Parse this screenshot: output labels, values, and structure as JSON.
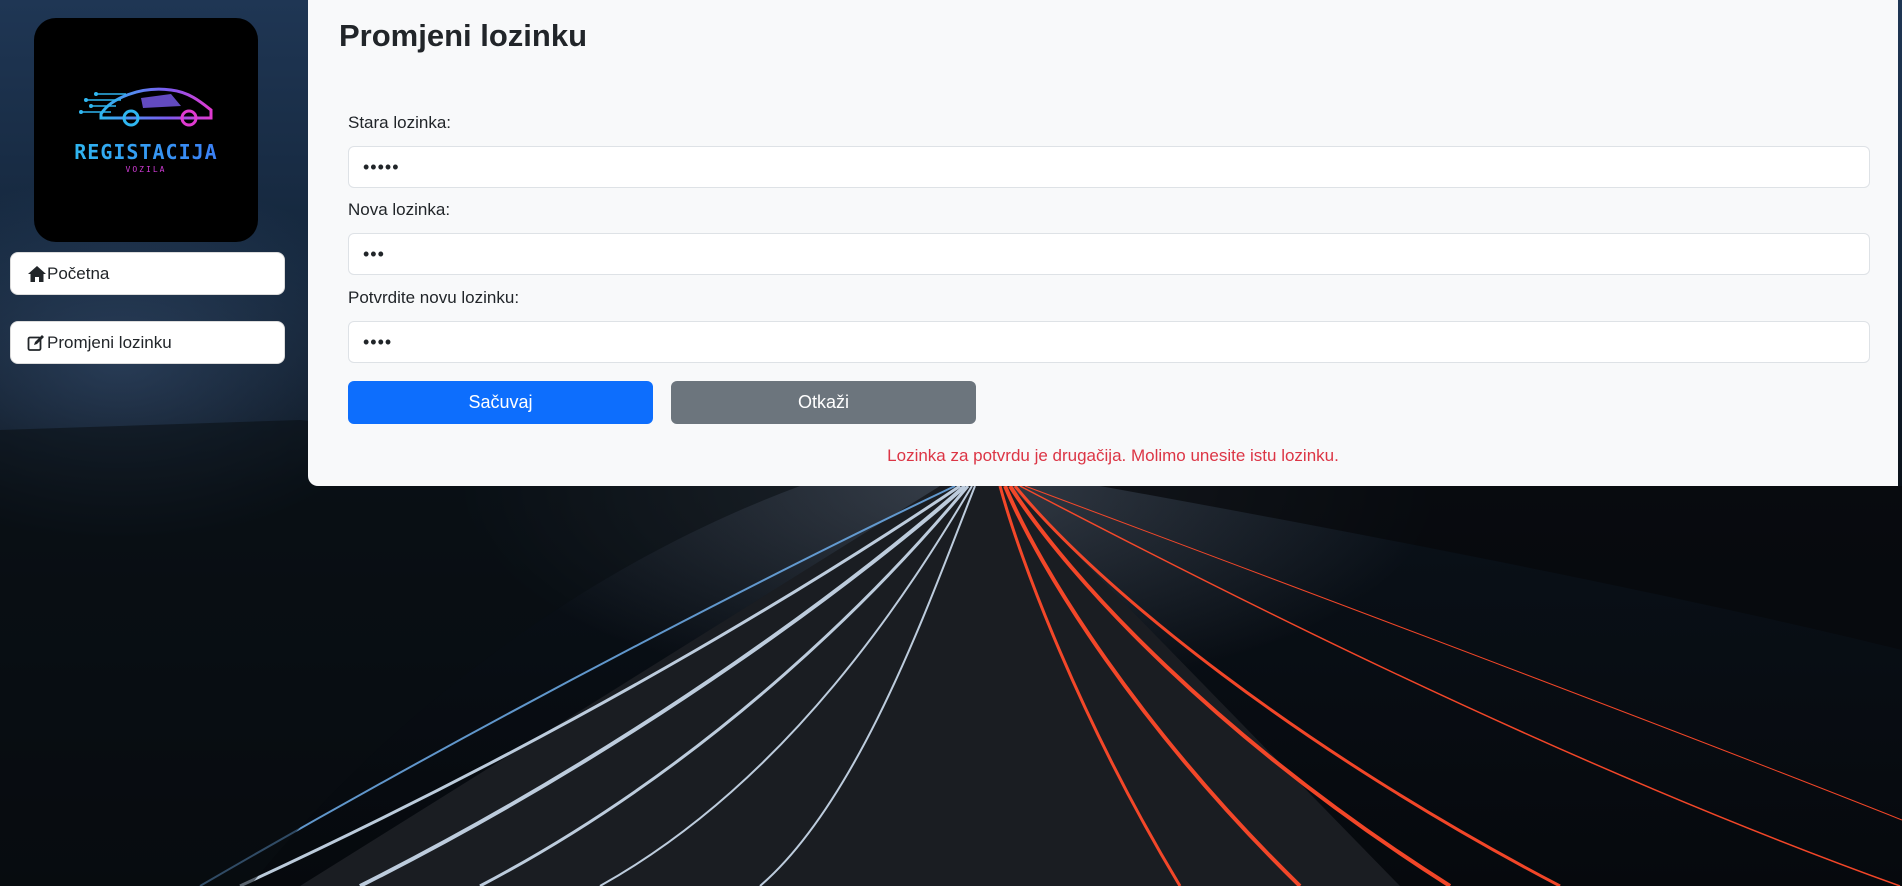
{
  "app": {
    "logo": {
      "title": "REGISTACIJA",
      "subtitle": "VOZILA",
      "colors": {
        "primary": "#2fb6f0",
        "accent": "#d13bd6"
      }
    }
  },
  "sidebar": {
    "items": [
      {
        "label": "Početna",
        "icon": "home-icon"
      },
      {
        "label": "Promjeni lozinku",
        "icon": "edit-icon"
      }
    ]
  },
  "form": {
    "title": "Promjeni lozinku",
    "fields": [
      {
        "label": "Stara lozinka:",
        "value": "•••••"
      },
      {
        "label": "Nova lozinka:",
        "value": "•••"
      },
      {
        "label": "Potvrdite novu lozinku:",
        "value": "••••"
      }
    ],
    "buttons": {
      "save": "Sačuvaj",
      "cancel": "Otkaži"
    },
    "error": "Lozinka za potvrdu je drugačija. Molimo unesite istu lozinku."
  },
  "theme": {
    "primary": "#0d6efd",
    "secondary": "#6c757d",
    "danger": "#dc3545",
    "panel_bg": "#f8f9fa"
  }
}
